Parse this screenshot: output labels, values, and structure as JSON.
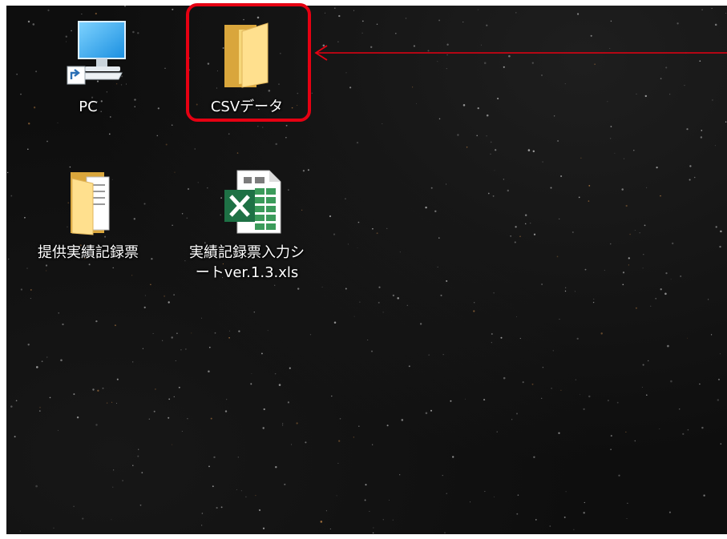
{
  "desktop": {
    "icons": [
      {
        "label": "PC",
        "icon": "pc-shortcut-icon"
      },
      {
        "label": "CSVデータ",
        "icon": "folder-icon"
      },
      {
        "label": "提供実績記録票",
        "icon": "folder-with-files-icon"
      },
      {
        "label": "実績記録票入力シートver.1.3.xls",
        "icon": "excel-file-icon"
      }
    ]
  },
  "annotation": {
    "highlight_color": "#e60012",
    "arrow_color": "#e60012"
  }
}
